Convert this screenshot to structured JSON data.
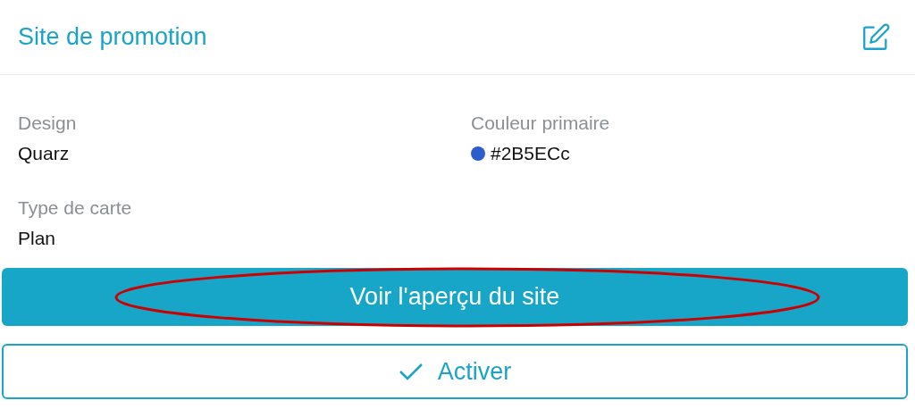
{
  "header": {
    "title": "Site de promotion"
  },
  "fields": [
    {
      "kind": "text",
      "label": "Design",
      "value": "Quarz"
    },
    {
      "kind": "color",
      "label": "Couleur primaire",
      "value": "#2B5ECc",
      "color": "#2b5ecc"
    },
    {
      "kind": "text",
      "label": "Type de carte",
      "value": "Plan"
    }
  ],
  "buttons": [
    {
      "kind": "primary",
      "label": "Voir l'aperçu du site",
      "annotated": true
    },
    {
      "kind": "outline",
      "label": "Activer",
      "annotated": false
    }
  ]
}
